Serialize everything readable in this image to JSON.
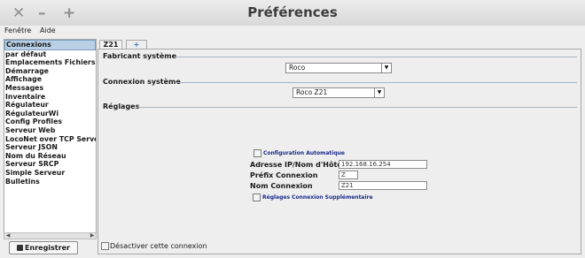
{
  "window": {
    "title": "Préférences",
    "close_glyph": "✕",
    "minimize_glyph": "–",
    "maximize_glyph": "+"
  },
  "menu": {
    "items": [
      "Fenêtre",
      "Aide"
    ]
  },
  "sidebar": {
    "items": [
      "Connexions",
      "par défaut",
      "Emplacements Fichiers",
      "Démarrage",
      "Affichage",
      "Messages",
      "Inventaire",
      "Régulateur",
      "RégulateurWi",
      "Config Profiles",
      "Serveur Web",
      "LocoNet over TCP Server",
      "Serveur JSON",
      "Nom du Réseau",
      "Serveur SRCP",
      "Simple Serveur",
      "Bulletins"
    ],
    "selected": 0
  },
  "save_button": {
    "label": "Enregistrer",
    "icon": "floppy-disk-icon"
  },
  "tabs": [
    {
      "label": "Z21"
    },
    {
      "label": "+"
    }
  ],
  "panel": {
    "manufacturer_label": "Fabricant système",
    "manufacturer_value": "Roco",
    "connection_label": "Connexion système",
    "connection_value": "Roco Z21",
    "settings_label": "Réglages",
    "auto_config_label": "Configuration Automatique",
    "ip_label": "Adresse IP/Nom d'Hôte:",
    "ip_value": "192.168.16.254",
    "prefix_label": "Préfix Connexion",
    "prefix_value": "Z",
    "name_label": "Nom Connexion",
    "name_value": "Z21",
    "extra_label": "Réglages Connexion Supplémentaire",
    "disable_label": "Désactiver cette connexion"
  }
}
